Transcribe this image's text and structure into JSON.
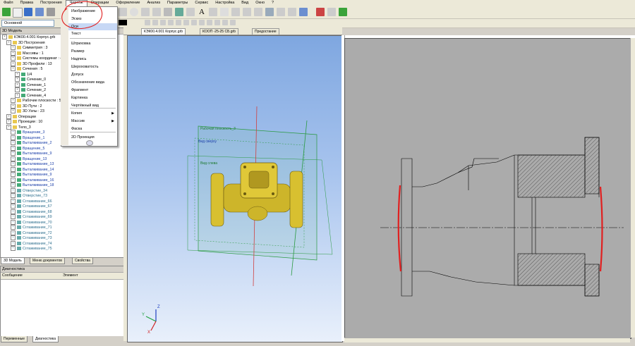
{
  "menubar": {
    "items": [
      "Файл",
      "Правка",
      "Построения",
      "Чертёж",
      "Операции",
      "Оформление",
      "Анализ",
      "Параметры",
      "Сервис",
      "Настройка",
      "Вид",
      "Окно",
      "?"
    ]
  },
  "toolbar": {
    "layer_combo": "Основной"
  },
  "doc_tabs": [
    "КЭК00.4.001 Корпус.grb",
    "КООП -25-25 СБ.grb",
    "Предостание"
  ],
  "tree": {
    "title": "3D Модель",
    "rows": [
      {
        "text": "КЭК00.4.001 Корпус.grb",
        "lvl": 0
      },
      {
        "text": "3D Построения",
        "lvl": 1
      },
      {
        "text": "Симметрия : 3",
        "lvl": 2
      },
      {
        "text": "Массивы : 1",
        "lvl": 2
      },
      {
        "text": "Системы координат : 4",
        "lvl": 2
      },
      {
        "text": "3D Профили : 13",
        "lvl": 2
      },
      {
        "text": "Сечения : 5",
        "lvl": 2
      },
      {
        "text": "1/4",
        "lvl": 3
      },
      {
        "text": "Сечение_0",
        "lvl": 3
      },
      {
        "text": "Сечение_1",
        "lvl": 3
      },
      {
        "text": "Сечение_2",
        "lvl": 3
      },
      {
        "text": "Сечение_4",
        "lvl": 3
      },
      {
        "text": "Рабочие плоскости : 5",
        "lvl": 2
      },
      {
        "text": "3D Пути : 2",
        "lvl": 2
      },
      {
        "text": "3D Узлы : 23",
        "lvl": 2
      },
      {
        "text": "Операции",
        "lvl": 1
      },
      {
        "text": "Проекции : 10",
        "lvl": 1
      },
      {
        "text": "Тело_3",
        "lvl": 1
      },
      {
        "text": "Вращение_3",
        "lvl": 2,
        "c": "blue"
      },
      {
        "text": "Вращение_1",
        "lvl": 2,
        "c": "blue"
      },
      {
        "text": "Выталкивание_2",
        "lvl": 2,
        "c": "blue"
      },
      {
        "text": "Вращение_5",
        "lvl": 2,
        "c": "blue"
      },
      {
        "text": "Выталкивание_9",
        "lvl": 2,
        "c": "blue"
      },
      {
        "text": "Вращение_13",
        "lvl": 2,
        "c": "blue"
      },
      {
        "text": "Выталкивание_13",
        "lvl": 2,
        "c": "blue"
      },
      {
        "text": "Выталкивание_14",
        "lvl": 2,
        "c": "blue"
      },
      {
        "text": "Выталкивание_9",
        "lvl": 2,
        "c": "blue"
      },
      {
        "text": "Выталкивание_16",
        "lvl": 2,
        "c": "blue"
      },
      {
        "text": "Выталкивание_18",
        "lvl": 2,
        "c": "blue"
      },
      {
        "text": "Отверстие_34",
        "lvl": 2,
        "c": "teal"
      },
      {
        "text": "Отверстие_73",
        "lvl": 2,
        "c": "teal"
      },
      {
        "text": "Сглаживание_66",
        "lvl": 2,
        "c": "teal"
      },
      {
        "text": "Сглаживание_67",
        "lvl": 2,
        "c": "teal"
      },
      {
        "text": "Сглаживание_68",
        "lvl": 2,
        "c": "teal"
      },
      {
        "text": "Сглаживание_69",
        "lvl": 2,
        "c": "teal"
      },
      {
        "text": "Сглаживание_70",
        "lvl": 2,
        "c": "teal"
      },
      {
        "text": "Сглаживание_71",
        "lvl": 2,
        "c": "teal"
      },
      {
        "text": "Сглаживание_72",
        "lvl": 2,
        "c": "teal"
      },
      {
        "text": "Сглаживание_73",
        "lvl": 2,
        "c": "teal"
      },
      {
        "text": "Сглаживание_74",
        "lvl": 2,
        "c": "teal"
      },
      {
        "text": "Сглаживание_75",
        "lvl": 2,
        "c": "teal"
      }
    ]
  },
  "tree_tabs": [
    "3D Модель",
    "Меню документов",
    "Свойства"
  ],
  "diagnostics": {
    "title": "Диагностика",
    "col_message": "Сообщение",
    "col_element": "Элемент"
  },
  "diag_tabs": [
    "Переменные",
    "Диагностика"
  ],
  "drawing_menu": {
    "items": [
      {
        "label": "Изображение",
        "arrow": ""
      },
      {
        "label": "Эскиз",
        "arrow": ""
      },
      {
        "label": "Оси",
        "arrow": ""
      },
      {
        "label": "Текст",
        "arrow": ""
      },
      {
        "label": "Штриховка",
        "arrow": ""
      },
      {
        "label": "Размер",
        "arrow": ""
      },
      {
        "label": "Надпись",
        "arrow": ""
      },
      {
        "label": "Шероховатость",
        "arrow": ""
      },
      {
        "label": "Допуск",
        "arrow": ""
      },
      {
        "label": "Обозначение вида",
        "arrow": ""
      },
      {
        "label": "Фрагмент",
        "arrow": ""
      },
      {
        "label": "Картинка",
        "arrow": ""
      },
      {
        "label": "Чертёжный вид",
        "arrow": ""
      },
      {
        "label": "Копия",
        "arrow": "▶"
      },
      {
        "label": "Массив",
        "arrow": "▶"
      },
      {
        "label": "Фаска",
        "arrow": ""
      },
      {
        "label": "2D Проекция",
        "arrow": ""
      }
    ]
  },
  "viewport3d": {
    "workplane_label": "Рабочая плоскость_3",
    "view_label_1": "Вид сверху",
    "view_label_2": "Вид слева",
    "axis_z": "Z",
    "axis_y": "Y",
    "axis_x": "X"
  },
  "colors": {
    "annotation_red": "#e02020",
    "body_yellow": "#d8c030",
    "workplane_green": "#2a9a40"
  }
}
